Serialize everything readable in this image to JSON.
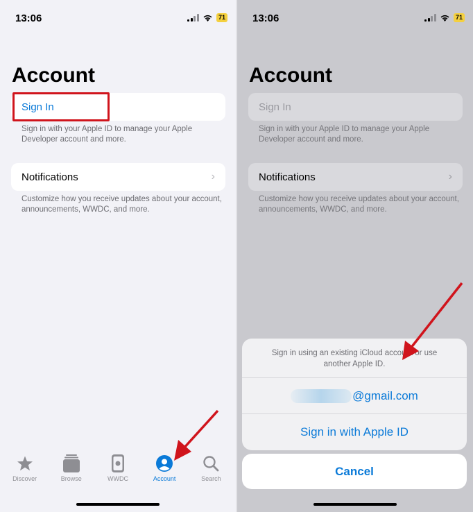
{
  "left": {
    "status": {
      "time": "13:06",
      "battery": "71"
    },
    "title": "Account",
    "sign_in": {
      "label": "Sign In",
      "description": "Sign in with your Apple ID to manage your Apple Developer account and more."
    },
    "notifications": {
      "label": "Notifications",
      "description": "Customize how you receive updates about your account, announcements, WWDC, and more."
    },
    "tabs": [
      {
        "label": "Discover",
        "icon": "star-icon"
      },
      {
        "label": "Browse",
        "icon": "stack-icon"
      },
      {
        "label": "WWDC",
        "icon": "phone-icon"
      },
      {
        "label": "Account",
        "icon": "person-circle-icon",
        "active": true
      },
      {
        "label": "Search",
        "icon": "search-icon"
      }
    ]
  },
  "right": {
    "status": {
      "time": "13:06",
      "battery": "71"
    },
    "title": "Account",
    "sign_in": {
      "label": "Sign In",
      "description": "Sign in with your Apple ID to manage your Apple Developer account and more."
    },
    "notifications": {
      "label": "Notifications",
      "description": "Customize how you receive updates about your account, announcements, WWDC, and more."
    },
    "sheet": {
      "message": "Sign in using an existing iCloud account or use another Apple ID.",
      "email_suffix": "@gmail.com",
      "apple_id_button": "Sign in with Apple ID",
      "cancel": "Cancel"
    }
  },
  "colors": {
    "accent": "#0a7ad8",
    "highlight": "#d0141c",
    "battery": "#f4d03f"
  }
}
